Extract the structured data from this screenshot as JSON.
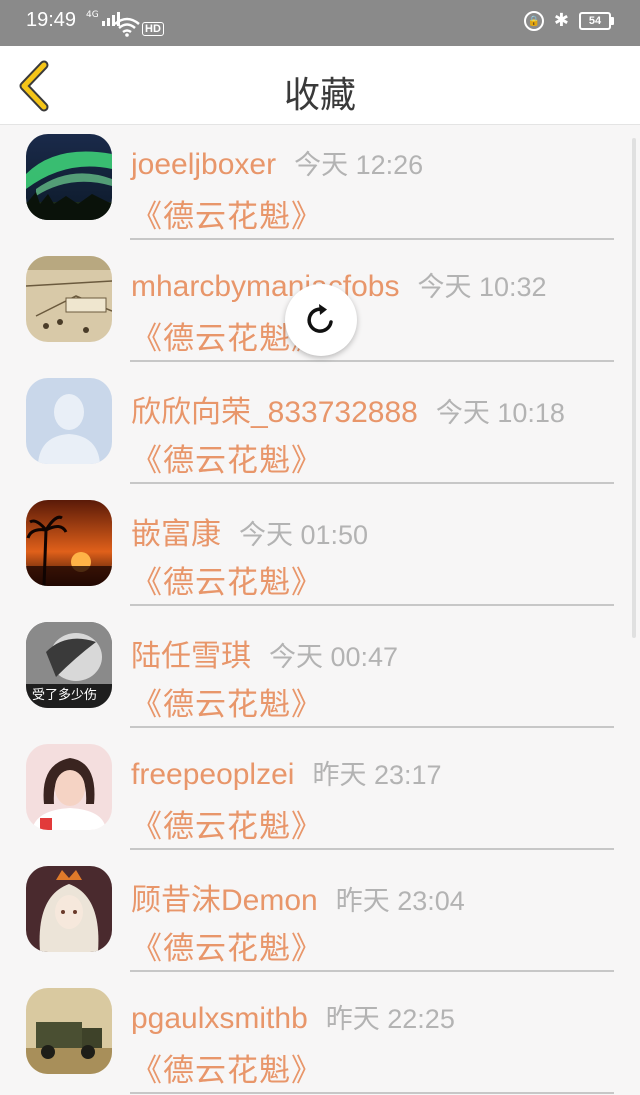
{
  "status_bar": {
    "time": "19:49",
    "network": "4G",
    "hd": "HD",
    "battery": "54"
  },
  "header": {
    "title": "收藏"
  },
  "favorites": [
    {
      "username": "joeeljboxer",
      "time": "今天 12:26",
      "book": "《德云花魁》",
      "avatar": "aurora-landscape-avatar"
    },
    {
      "username": "mharcbymaniacfobs",
      "time": "今天 10:32",
      "book": "《德云花魁》",
      "avatar": "sketch-map-avatar"
    },
    {
      "username": "欣欣向荣_833732888",
      "time": "今天 10:18",
      "book": "《德云花魁》",
      "avatar": "default-silhouette-avatar"
    },
    {
      "username": "嵌富康",
      "time": "今天 01:50",
      "book": "《德云花魁》",
      "avatar": "sunset-palm-avatar"
    },
    {
      "username": "陆任雪琪",
      "time": "今天 00:47",
      "book": "《德云花魁》",
      "avatar": "bw-photo-avatar",
      "avatar_caption": "受了多少伤"
    },
    {
      "username": "freepeoplzei",
      "time": "昨天 23:17",
      "book": "《德云花魁》",
      "avatar": "girl-photo-avatar"
    },
    {
      "username": "顾昔沫Demon",
      "time": "昨天 23:04",
      "book": "《德云花魁》",
      "avatar": "anime-girl-avatar"
    },
    {
      "username": "pgaulxsmithb",
      "time": "昨天 22:25",
      "book": "《德云花魁》",
      "avatar": "military-truck-avatar"
    }
  ],
  "colors": {
    "accent_orange": "#e8966a",
    "timestamp_gray": "#b3b3b3",
    "back_arrow": "#f5c518"
  }
}
